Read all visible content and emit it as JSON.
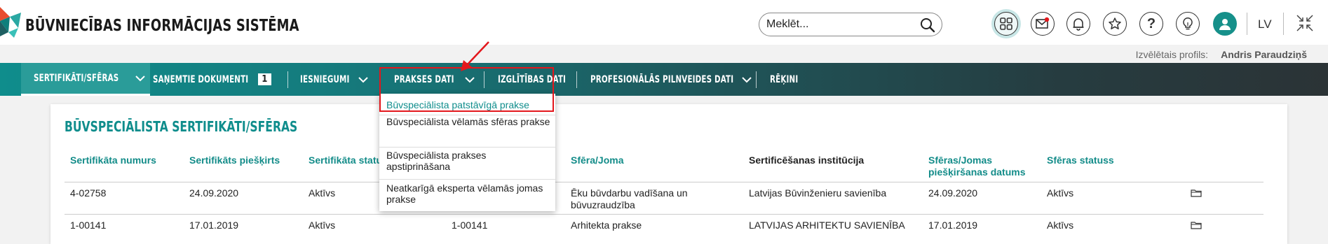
{
  "app": {
    "title": "BŪVNIECĪBAS INFORMĀCIJAS SISTĒMA"
  },
  "search": {
    "placeholder": "Meklēt..."
  },
  "header": {
    "icons": [
      "apps-icon",
      "messages-icon",
      "bell-icon",
      "star-icon",
      "help-icon",
      "lightbulb-icon",
      "user-icon"
    ],
    "language": "LV",
    "profile_label": "Izvēlētais profils:",
    "profile_name": "Andris Paraudziņš"
  },
  "nav": {
    "items": [
      {
        "label": "SERTIFIKĀTI/SFĒRAS"
      },
      {
        "label": "SAŅEMTIE DOKUMENTI",
        "badge": "1"
      },
      {
        "label": "IESNIEGUMI"
      },
      {
        "label": "PRAKSES DATI"
      },
      {
        "label": "IZGLĪTĪBAS DATI"
      },
      {
        "label": "PROFESIONĀLĀS PILNVEIDES DATI"
      },
      {
        "label": "RĒĶINI"
      }
    ]
  },
  "dropdown": {
    "items": [
      "Būvspeciālista patstāvīgā prakse",
      "Būvspeciālista vēlamās sfēras prakse",
      "Būvspeciālista prakses apstiprināšana",
      "Neatkarīgā eksperta vēlamās jomas prakse"
    ]
  },
  "main": {
    "title": "BŪVSPECIĀLISTA SERTIFIKĀTI/SFĒRAS",
    "columns": [
      "Sertifikāta numurs",
      "Sertifikāts piešķirts",
      "Sertifikāta statuss",
      "Sfēra/Joma",
      "Sertificēšanas institūcija",
      "Sfēras/Jomas piešķiršanas datums",
      "Sfēras statuss"
    ],
    "rows": [
      [
        "4-02758",
        "24.09.2020",
        "Aktīvs",
        "",
        "Ēku būvdarbu vadīšana un būvuzraudzība",
        "Latvijas Būvinženieru savienība",
        "24.09.2020",
        "Aktīvs"
      ],
      [
        "1-00141",
        "17.01.2019",
        "Aktīvs",
        "1-00141",
        "Arhitekta prakse",
        "LATVIJAS ARHITEKTU SAVIENĪBA",
        "17.01.2019",
        "Aktīvs"
      ]
    ]
  },
  "colors": {
    "accent": "#0f8d8c",
    "highlight": "#e3171c"
  }
}
